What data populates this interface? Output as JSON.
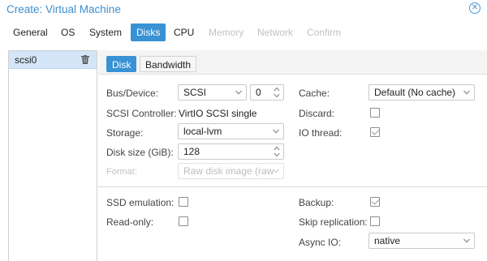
{
  "window": {
    "title": "Create: Virtual Machine"
  },
  "tabs": [
    {
      "label": "General",
      "state": "normal"
    },
    {
      "label": "OS",
      "state": "normal"
    },
    {
      "label": "System",
      "state": "normal"
    },
    {
      "label": "Disks",
      "state": "active"
    },
    {
      "label": "CPU",
      "state": "normal"
    },
    {
      "label": "Memory",
      "state": "disabled"
    },
    {
      "label": "Network",
      "state": "disabled"
    },
    {
      "label": "Confirm",
      "state": "disabled"
    }
  ],
  "sidebar": {
    "items": [
      {
        "label": "scsi0",
        "selected": true
      }
    ]
  },
  "subtabs": [
    {
      "label": "Disk",
      "active": true
    },
    {
      "label": "Bandwidth",
      "active": false
    }
  ],
  "form": {
    "bus_label": "Bus/Device:",
    "bus_value": "SCSI",
    "device_value": "0",
    "controller_label": "SCSI Controller:",
    "controller_value": "VirtIO SCSI single",
    "storage_label": "Storage:",
    "storage_value": "local-lvm",
    "disksize_label": "Disk size (GiB):",
    "disksize_value": "128",
    "format_label": "Format:",
    "format_value": "Raw disk image (raw",
    "cache_label": "Cache:",
    "cache_value": "Default (No cache)",
    "discard_label": "Discard:",
    "discard_checked": false,
    "iothread_label": "IO thread:",
    "iothread_checked": true,
    "ssd_label": "SSD emulation:",
    "ssd_checked": false,
    "readonly_label": "Read-only:",
    "readonly_checked": false,
    "backup_label": "Backup:",
    "backup_checked": true,
    "skiprep_label": "Skip replication:",
    "skiprep_checked": false,
    "asyncio_label": "Async IO:",
    "asyncio_value": "native"
  },
  "icons": {
    "close": "close-circle-icon",
    "trash": "trash-icon",
    "dropdown": "chevron-down-icon",
    "spinner": "spinner-arrows-icon"
  },
  "colors": {
    "accent": "#3892d4",
    "title": "#3c8fd0",
    "selected_row": "#d3e5f6",
    "disabled_text": "#c2c2c2"
  }
}
